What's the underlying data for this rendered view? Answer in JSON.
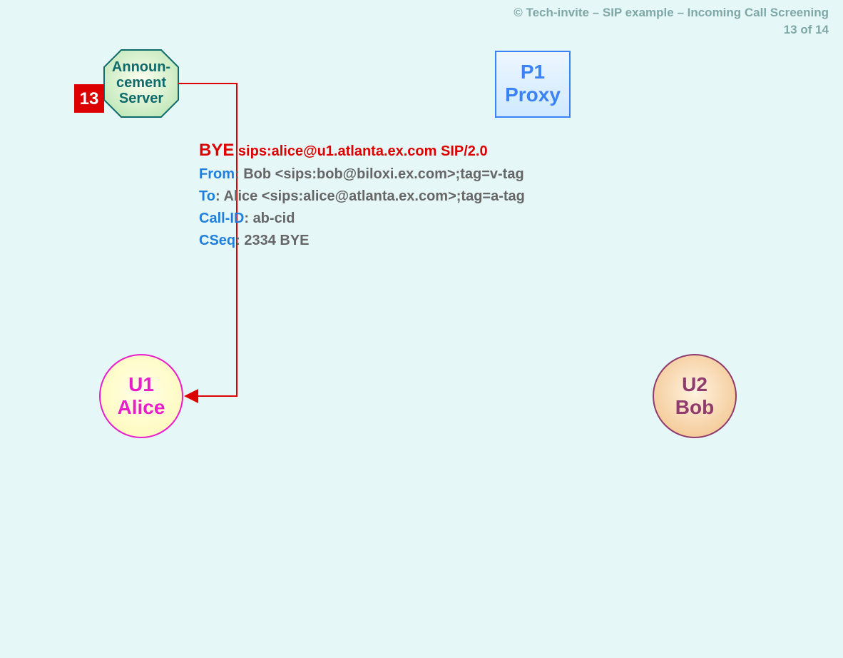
{
  "header": {
    "line1": "© Tech-invite – SIP example – Incoming Call Screening",
    "line2": "13 of 14"
  },
  "step": {
    "number": "13"
  },
  "nodes": {
    "announcement": {
      "line1": "Announ-",
      "line2": "cement",
      "line3": "Server"
    },
    "proxy": {
      "line1": "P1",
      "line2": "Proxy"
    },
    "u1": {
      "line1": "U1",
      "line2": "Alice"
    },
    "u2": {
      "line1": "U2",
      "line2": "Bob"
    }
  },
  "message": {
    "method": "BYE",
    "request_uri": "sips:alice@u1.atlanta.ex.com SIP/2.0",
    "headers": {
      "from": {
        "name": "From",
        "value": "Bob <sips:bob@biloxi.ex.com>;tag=v-tag"
      },
      "to": {
        "name": "To",
        "value": "Alice <sips:alice@atlanta.ex.com>;tag=a-tag"
      },
      "callid": {
        "name": "Call-ID",
        "value": "ab-cid"
      },
      "cseq": {
        "name": "CSeq",
        "value": "2334 BYE"
      }
    }
  }
}
